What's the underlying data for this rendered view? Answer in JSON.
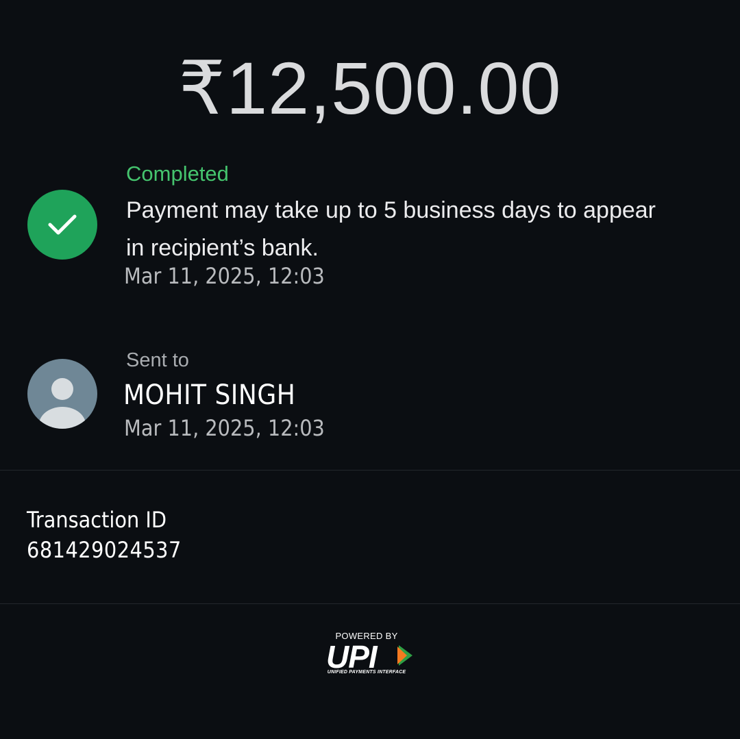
{
  "amount": "₹12,500.00",
  "status": {
    "label": "Completed",
    "message": "Payment may take up to 5 business days to appear in recipient’s bank.",
    "timestamp": "Mar 11, 2025, 12:03",
    "icon": "check-circle-icon",
    "color": "#1fa35a"
  },
  "recipient": {
    "label": "Sent to",
    "name": "MOHIT SINGH",
    "timestamp": "Mar 11, 2025, 12:03",
    "icon": "person-avatar-icon"
  },
  "transaction": {
    "label": "Transaction ID",
    "id": "681429024537"
  },
  "footer": {
    "powered_by": "POWERED BY",
    "brand": "UPI",
    "brand_full": "UNIFIED PAYMENTS INTERFACE"
  }
}
